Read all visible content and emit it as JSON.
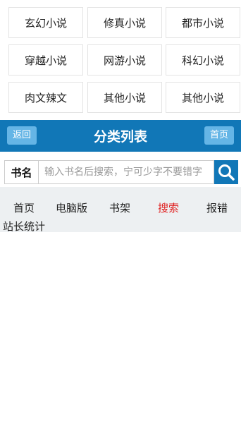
{
  "categories": [
    "玄幻小说",
    "修真小说",
    "都市小说",
    "穿越小说",
    "网游小说",
    "科幻小说",
    "肉文辣文",
    "其他小说",
    "其他小说"
  ],
  "header": {
    "title": "分类列表",
    "back_label": "返回",
    "home_label": "首页"
  },
  "search": {
    "label": "书名",
    "placeholder": "输入书名后搜索，宁可少字不要错字",
    "button_icon": "search-icon"
  },
  "nav": {
    "items": [
      "首页",
      "电脑版",
      "书架",
      "搜索",
      "报错"
    ],
    "active_index": 3,
    "stats_label": "站长统计"
  },
  "colors": {
    "primary": "#1177b7",
    "button_light": "#65b5e6",
    "active": "#e02020",
    "nav_bg": "#edf0f2"
  }
}
